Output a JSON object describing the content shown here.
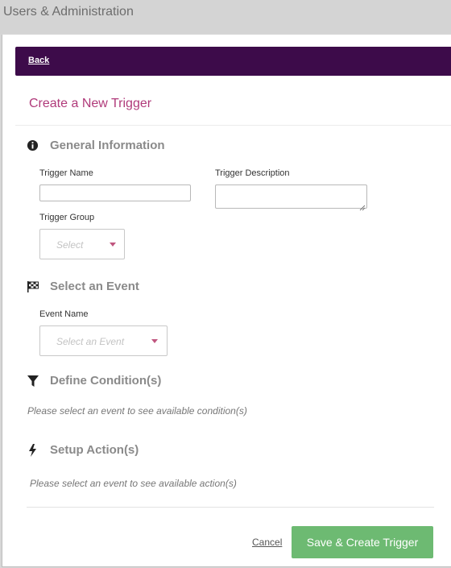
{
  "window": {
    "title": "Users & Administration"
  },
  "nav": {
    "back_label": "Back"
  },
  "page": {
    "title": "Create a New Trigger"
  },
  "sections": {
    "general": {
      "title": "General Information",
      "icon": "info-icon",
      "trigger_name_label": "Trigger Name",
      "trigger_name_value": "",
      "trigger_description_label": "Trigger Description",
      "trigger_description_value": "",
      "trigger_group_label": "Trigger Group",
      "trigger_group_placeholder": "Select"
    },
    "event": {
      "title": "Select an Event",
      "icon": "checkered-flag-icon",
      "event_name_label": "Event Name",
      "event_name_placeholder": "Select an Event"
    },
    "conditions": {
      "title": "Define Condition(s)",
      "icon": "filter-icon",
      "hint": "Please select an event to see available condition(s)"
    },
    "actions": {
      "title": "Setup Action(s)",
      "icon": "lightning-bolt-icon",
      "hint": "Please select an event to see available action(s)"
    }
  },
  "footer": {
    "cancel_label": "Cancel",
    "save_label": "Save & Create Trigger"
  },
  "colors": {
    "header_bar": "#3d0b4a",
    "title_accent": "#b03a7a",
    "primary_button": "#6dba72",
    "caret": "#c0567f"
  }
}
